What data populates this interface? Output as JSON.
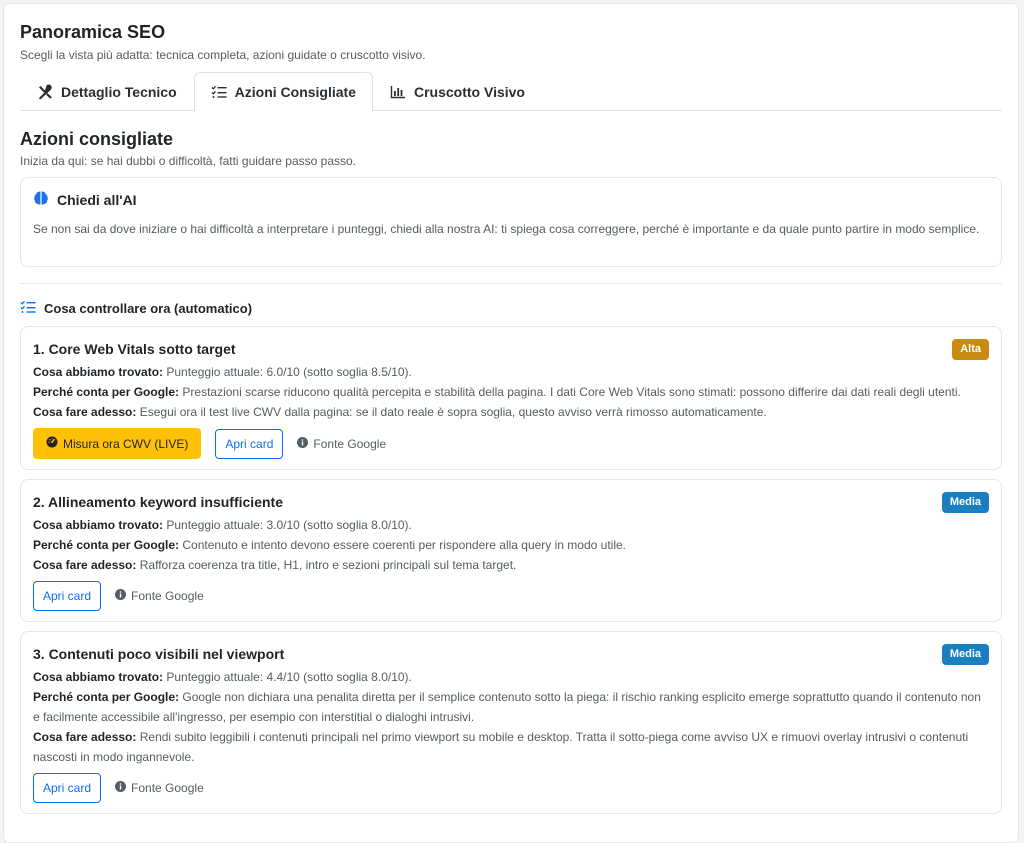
{
  "header": {
    "title": "Panoramica SEO",
    "subtitle": "Scegli la vista più adatta: tecnica completa, azioni guidate o cruscotto visivo."
  },
  "tabs": [
    {
      "label": "Dettaglio Tecnico",
      "icon": "tools-icon",
      "active": false
    },
    {
      "label": "Azioni Consigliate",
      "icon": "checklist-icon",
      "active": true
    },
    {
      "label": "Cruscotto Visivo",
      "icon": "bar-chart-icon",
      "active": false
    }
  ],
  "section": {
    "title": "Azioni consigliate",
    "subtitle": "Inizia da qui: se hai dubbi o difficoltà, fatti guidare passo passo."
  },
  "ai_card": {
    "title": "Chiedi all'AI",
    "text": "Se non sai da dove iniziare o hai difficoltà a interpretare i punteggi, chiedi alla nostra AI: ti spiega cosa correggere, perché è importante e da quale punto partire in modo semplice.",
    "icon": "brain-icon"
  },
  "auto": {
    "title": "Cosa controllare ora (automatico)"
  },
  "labels": {
    "found": "Cosa abbiamo trovato:",
    "why": "Perché conta per Google:",
    "todo": "Cosa fare adesso:",
    "open_card": "Apri card",
    "source": "Fonte Google"
  },
  "issues": [
    {
      "title": "1. Core Web Vitals sotto target",
      "priority": "Alta",
      "found": "Punteggio attuale: 6.0/10 (sotto soglia 8.5/10).",
      "why": "Prestazioni scarse riducono qualità percepita e stabilità della pagina. I dati Core Web Vitals sono stimati: possono differire dai dati reali degli utenti.",
      "todo": "Esegui ora il test live CWV dalla pagina: se il dato reale è sopra soglia, questo avviso verrà rimosso automaticamente.",
      "measure_label": "Misura ora CWV (LIVE)"
    },
    {
      "title": "2. Allineamento keyword insufficiente",
      "priority": "Media",
      "found": "Punteggio attuale: 3.0/10 (sotto soglia 8.0/10).",
      "why": "Contenuto e intento devono essere coerenti per rispondere alla query in modo utile.",
      "todo": "Rafforza coerenza tra title, H1, intro e sezioni principali sul tema target."
    },
    {
      "title": "3. Contenuti poco visibili nel viewport",
      "priority": "Media",
      "found": "Punteggio attuale: 4.4/10 (sotto soglia 8.0/10).",
      "why": "Google non dichiara una penalita diretta per il semplice contenuto sotto la piega: il rischio ranking esplicito emerge soprattutto quando il contenuto non e facilmente accessibile all'ingresso, per esempio con interstitial o dialoghi intrusivi.",
      "todo": "Rendi subito leggibili i contenuti principali nel primo viewport su mobile e desktop. Tratta il sotto-piega come avviso UX e rimuovi overlay intrusivi o contenuti nascosti in modo ingannevole."
    }
  ],
  "colors": {
    "alta": "#c98a12",
    "media": "#1a7fbf",
    "warning": "#ffc107",
    "primary": "#0d6efd",
    "ai_icon": "#1a73e8"
  }
}
